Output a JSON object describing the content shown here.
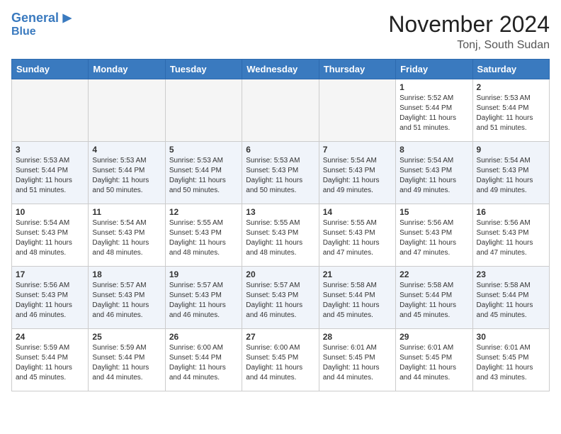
{
  "header": {
    "logo_line1": "General",
    "logo_line2": "Blue",
    "month": "November 2024",
    "location": "Tonj, South Sudan"
  },
  "weekdays": [
    "Sunday",
    "Monday",
    "Tuesday",
    "Wednesday",
    "Thursday",
    "Friday",
    "Saturday"
  ],
  "weeks": [
    [
      {
        "day": "",
        "info": ""
      },
      {
        "day": "",
        "info": ""
      },
      {
        "day": "",
        "info": ""
      },
      {
        "day": "",
        "info": ""
      },
      {
        "day": "",
        "info": ""
      },
      {
        "day": "1",
        "info": "Sunrise: 5:52 AM\nSunset: 5:44 PM\nDaylight: 11 hours\nand 51 minutes."
      },
      {
        "day": "2",
        "info": "Sunrise: 5:53 AM\nSunset: 5:44 PM\nDaylight: 11 hours\nand 51 minutes."
      }
    ],
    [
      {
        "day": "3",
        "info": "Sunrise: 5:53 AM\nSunset: 5:44 PM\nDaylight: 11 hours\nand 51 minutes."
      },
      {
        "day": "4",
        "info": "Sunrise: 5:53 AM\nSunset: 5:44 PM\nDaylight: 11 hours\nand 50 minutes."
      },
      {
        "day": "5",
        "info": "Sunrise: 5:53 AM\nSunset: 5:44 PM\nDaylight: 11 hours\nand 50 minutes."
      },
      {
        "day": "6",
        "info": "Sunrise: 5:53 AM\nSunset: 5:43 PM\nDaylight: 11 hours\nand 50 minutes."
      },
      {
        "day": "7",
        "info": "Sunrise: 5:54 AM\nSunset: 5:43 PM\nDaylight: 11 hours\nand 49 minutes."
      },
      {
        "day": "8",
        "info": "Sunrise: 5:54 AM\nSunset: 5:43 PM\nDaylight: 11 hours\nand 49 minutes."
      },
      {
        "day": "9",
        "info": "Sunrise: 5:54 AM\nSunset: 5:43 PM\nDaylight: 11 hours\nand 49 minutes."
      }
    ],
    [
      {
        "day": "10",
        "info": "Sunrise: 5:54 AM\nSunset: 5:43 PM\nDaylight: 11 hours\nand 48 minutes."
      },
      {
        "day": "11",
        "info": "Sunrise: 5:54 AM\nSunset: 5:43 PM\nDaylight: 11 hours\nand 48 minutes."
      },
      {
        "day": "12",
        "info": "Sunrise: 5:55 AM\nSunset: 5:43 PM\nDaylight: 11 hours\nand 48 minutes."
      },
      {
        "day": "13",
        "info": "Sunrise: 5:55 AM\nSunset: 5:43 PM\nDaylight: 11 hours\nand 48 minutes."
      },
      {
        "day": "14",
        "info": "Sunrise: 5:55 AM\nSunset: 5:43 PM\nDaylight: 11 hours\nand 47 minutes."
      },
      {
        "day": "15",
        "info": "Sunrise: 5:56 AM\nSunset: 5:43 PM\nDaylight: 11 hours\nand 47 minutes."
      },
      {
        "day": "16",
        "info": "Sunrise: 5:56 AM\nSunset: 5:43 PM\nDaylight: 11 hours\nand 47 minutes."
      }
    ],
    [
      {
        "day": "17",
        "info": "Sunrise: 5:56 AM\nSunset: 5:43 PM\nDaylight: 11 hours\nand 46 minutes."
      },
      {
        "day": "18",
        "info": "Sunrise: 5:57 AM\nSunset: 5:43 PM\nDaylight: 11 hours\nand 46 minutes."
      },
      {
        "day": "19",
        "info": "Sunrise: 5:57 AM\nSunset: 5:43 PM\nDaylight: 11 hours\nand 46 minutes."
      },
      {
        "day": "20",
        "info": "Sunrise: 5:57 AM\nSunset: 5:43 PM\nDaylight: 11 hours\nand 46 minutes."
      },
      {
        "day": "21",
        "info": "Sunrise: 5:58 AM\nSunset: 5:44 PM\nDaylight: 11 hours\nand 45 minutes."
      },
      {
        "day": "22",
        "info": "Sunrise: 5:58 AM\nSunset: 5:44 PM\nDaylight: 11 hours\nand 45 minutes."
      },
      {
        "day": "23",
        "info": "Sunrise: 5:58 AM\nSunset: 5:44 PM\nDaylight: 11 hours\nand 45 minutes."
      }
    ],
    [
      {
        "day": "24",
        "info": "Sunrise: 5:59 AM\nSunset: 5:44 PM\nDaylight: 11 hours\nand 45 minutes."
      },
      {
        "day": "25",
        "info": "Sunrise: 5:59 AM\nSunset: 5:44 PM\nDaylight: 11 hours\nand 44 minutes."
      },
      {
        "day": "26",
        "info": "Sunrise: 6:00 AM\nSunset: 5:44 PM\nDaylight: 11 hours\nand 44 minutes."
      },
      {
        "day": "27",
        "info": "Sunrise: 6:00 AM\nSunset: 5:45 PM\nDaylight: 11 hours\nand 44 minutes."
      },
      {
        "day": "28",
        "info": "Sunrise: 6:01 AM\nSunset: 5:45 PM\nDaylight: 11 hours\nand 44 minutes."
      },
      {
        "day": "29",
        "info": "Sunrise: 6:01 AM\nSunset: 5:45 PM\nDaylight: 11 hours\nand 44 minutes."
      },
      {
        "day": "30",
        "info": "Sunrise: 6:01 AM\nSunset: 5:45 PM\nDaylight: 11 hours\nand 43 minutes."
      }
    ]
  ]
}
